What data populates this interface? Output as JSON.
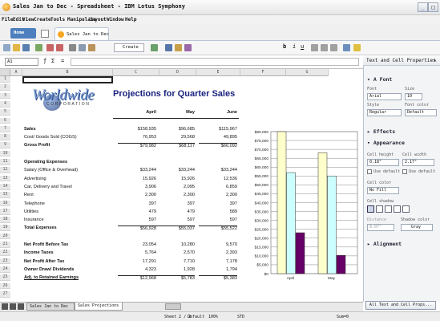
{
  "window": {
    "title": "Sales Jan to Dec - Spreadsheet - IBM Lotus Symphony"
  },
  "menu": [
    "File",
    "Edit",
    "View",
    "Create",
    "Tools",
    "Manipulate",
    "Layout",
    "Window",
    "Help"
  ],
  "tabs": {
    "home_label": "Home",
    "doc_tab": "Sales Jan to Dec"
  },
  "toolbar": {
    "create_label": "Create"
  },
  "formula_bar": {
    "cell_ref": "A1",
    "value": ""
  },
  "sheet": {
    "columns": [
      "A",
      "B",
      "C",
      "D",
      "E",
      "F",
      "G"
    ],
    "rows": [
      "1",
      "2",
      "3",
      "4",
      "5",
      "6",
      "7",
      "8",
      "9",
      "10",
      "11",
      "12",
      "13",
      "14",
      "15",
      "16",
      "17",
      "18",
      "19",
      "20",
      "21",
      "22",
      "23",
      "24",
      "25",
      "26",
      "27"
    ],
    "logo_text": "Worldwide",
    "logo_sub": "CORPORATION",
    "title": "Projections for Quarter Sales",
    "month_headers": [
      "April",
      "May",
      "June"
    ],
    "lines": [
      {
        "row": 7,
        "label": "Sales",
        "bold": true,
        "v": [
          "$158,935",
          "$96,685",
          "$115,967"
        ]
      },
      {
        "row": 8,
        "label": "Cost/ Goods Sold (COGS)",
        "bold": false,
        "v": [
          "76,953",
          "29,568",
          "49,895"
        ]
      },
      {
        "row": 9,
        "label": "Gross Profit",
        "bold": true,
        "v": [
          "$79,982",
          "$68,117",
          "$66,092"
        ]
      },
      {
        "row": 11,
        "label": "Operating Expenses",
        "bold": true,
        "v": [
          "",
          "",
          ""
        ]
      },
      {
        "row": 12,
        "label": "Salary (Office & Overhead)",
        "bold": false,
        "v": [
          "$33,244",
          "$33,244",
          "$33,244"
        ]
      },
      {
        "row": 13,
        "label": "Advertising",
        "bold": false,
        "v": [
          "15,926",
          "15,926",
          "12,536"
        ]
      },
      {
        "row": 14,
        "label": "Car, Delivery and Travel",
        "bold": false,
        "v": [
          "3,906",
          "2,095",
          "6,859"
        ]
      },
      {
        "row": 15,
        "label": "Rent",
        "bold": false,
        "v": [
          "2,300",
          "2,300",
          "2,300"
        ]
      },
      {
        "row": 16,
        "label": "Telephone",
        "bold": false,
        "v": [
          "397",
          "397",
          "397"
        ]
      },
      {
        "row": 17,
        "label": "Utilities",
        "bold": false,
        "v": [
          "479",
          "479",
          "589"
        ]
      },
      {
        "row": 18,
        "label": "Insurance",
        "bold": false,
        "v": [
          "597",
          "597",
          "597"
        ]
      },
      {
        "row": 19,
        "label": "Total Expenses",
        "bold": true,
        "v": [
          "$56,928",
          "$55,037",
          "$55,522"
        ]
      },
      {
        "row": 21,
        "label": "Net Profit Before Tax",
        "bold": true,
        "v": [
          "23,054",
          "10,280",
          "9,570"
        ]
      },
      {
        "row": 22,
        "label": "Income Taxes",
        "bold": true,
        "v": [
          "5,764",
          "2,570",
          "2,393"
        ]
      },
      {
        "row": 23,
        "label": "Net Profit After Tax",
        "bold": true,
        "v": [
          "17,291",
          "7,710",
          "7,178"
        ]
      },
      {
        "row": 24,
        "label": "Owner Draw/ Dividends",
        "bold": true,
        "v": [
          "4,323",
          "1,928",
          "1,794"
        ]
      },
      {
        "row": 25,
        "label": "Adj. to Retained Earnings",
        "bold": true,
        "v": [
          "$12,968",
          "$5,783",
          "$5,383"
        ]
      }
    ]
  },
  "chart_data": {
    "type": "bar",
    "categories": [
      "April",
      "May"
    ],
    "series": [
      {
        "values": [
          79982,
          68117
        ],
        "color": "#ffffcc"
      },
      {
        "values": [
          56928,
          55037
        ],
        "color": "#ccffff"
      },
      {
        "values": [
          23054,
          10280
        ],
        "color": "#660066"
      }
    ],
    "ylim": [
      0,
      80000
    ],
    "y_ticks": [
      "$0",
      "$5,000",
      "$10,000",
      "$15,000",
      "$20,000",
      "$25,000",
      "$30,000",
      "$35,000",
      "$40,000",
      "$45,000",
      "$50,000",
      "$55,000",
      "$60,000",
      "$65,000",
      "$70,000",
      "$75,000",
      "$80,000"
    ],
    "grid": true
  },
  "sheet_tabs": [
    "Sales Jan to Dec",
    "Sales Projections"
  ],
  "panel": {
    "title": "Text and Cell Properties",
    "font_section": "Font",
    "font_label": "Font",
    "size_label": "Size",
    "font_value": "Arial",
    "size_value": "10",
    "style_label": "Style",
    "color_label": "Font color",
    "style_value": "Regular",
    "color_value": "Default",
    "effects_section": "Effects",
    "appearance_section": "Appearance",
    "cell_height_label": "Cell height",
    "cell_width_label": "Cell width",
    "cell_height_value": "0.18\"",
    "cell_width_value": "2.17\"",
    "use_default_1": "Use default",
    "use_default_2": "Use default",
    "cell_color_label": "Cell color",
    "cell_color_value": "No Fill",
    "cell_shadow_label": "Cell shadow",
    "distance_label": "Distance",
    "shadow_color_label": "Shadow color",
    "distance_value": "0.07\"",
    "shadow_color_value": "Gray",
    "alignment_section": "Alignment",
    "all_props_button": "All Text and Cell Props..."
  },
  "status": {
    "sheet": "Sheet 2 / 2",
    "page_style": "Default",
    "zoom": "100%",
    "mode": "STD",
    "sum": "Sum=0"
  }
}
